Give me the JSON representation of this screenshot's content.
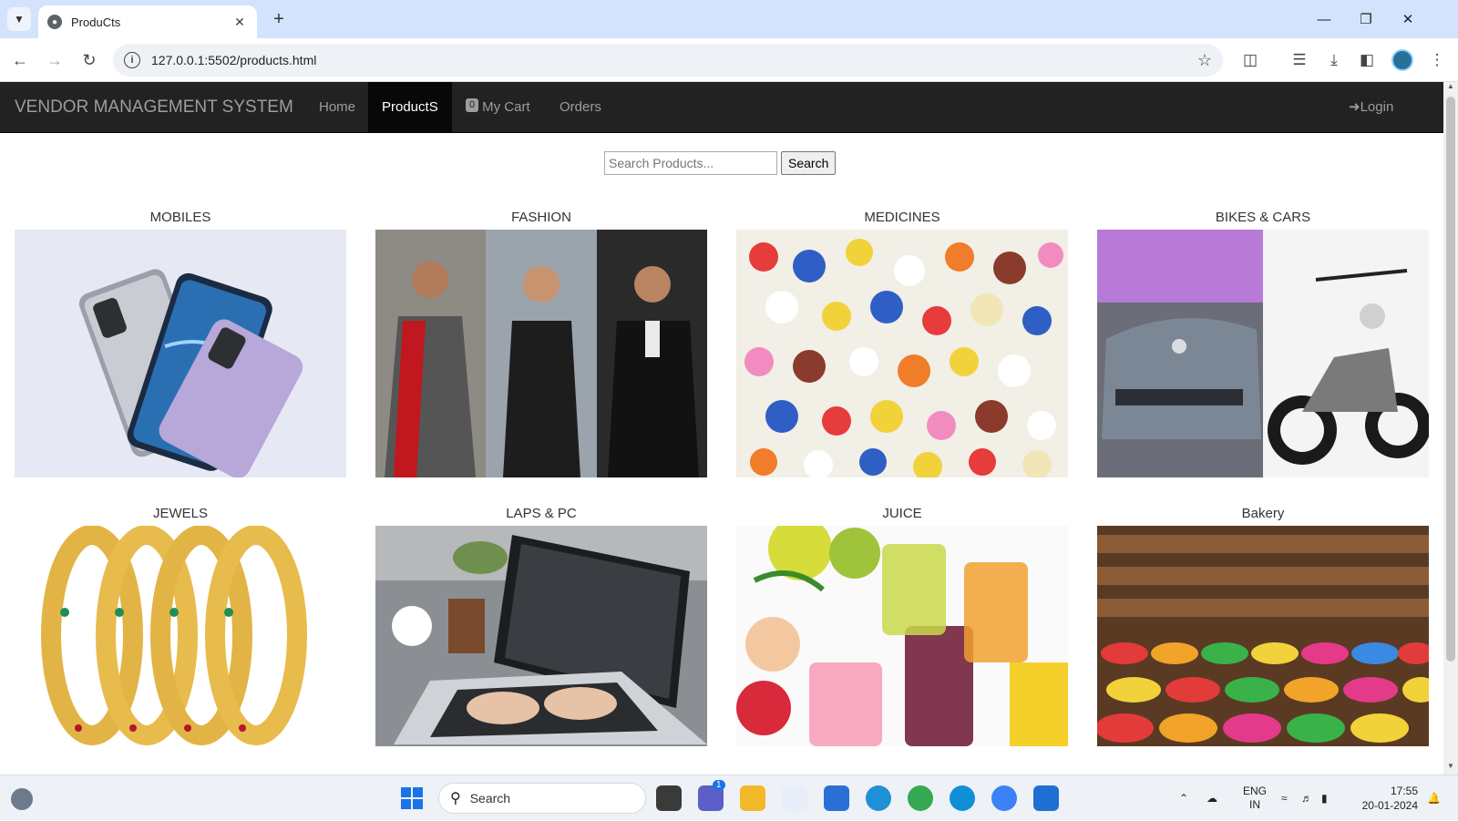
{
  "browser": {
    "tab_title": "ProduCts",
    "url": "127.0.0.1:5502/products.html"
  },
  "navbar": {
    "brand": "VENDOR MANAGEMENT SYSTEM",
    "links": [
      "Home",
      "ProductS",
      "My Cart",
      "Orders"
    ],
    "cart_count": "0",
    "login": "Login"
  },
  "search": {
    "placeholder": "Search Products...",
    "button": "Search"
  },
  "categories": [
    {
      "title": "MOBILES",
      "image": "phones"
    },
    {
      "title": "FASHION",
      "image": "fashion-models"
    },
    {
      "title": "MEDICINES",
      "image": "pills"
    },
    {
      "title": "BIKES & CARS",
      "image": "car-and-motorcycle"
    },
    {
      "title": "JEWELS",
      "image": "gold-bangles"
    },
    {
      "title": "LAPS & PC",
      "image": "laptop"
    },
    {
      "title": "JUICE",
      "image": "juices-and-fruits"
    },
    {
      "title": "Bakery",
      "image": "sweets-shop"
    }
  ],
  "taskbar": {
    "search_label": "Search",
    "notification_count": "1",
    "language": "ENG",
    "region": "IN",
    "time": "17:55",
    "date": "20-01-2024"
  },
  "colors": {
    "navbar_bg": "#222222",
    "nav_active_bg": "#080808",
    "nav_text": "#9d9d9d",
    "tabstrip": "#d3e3fd"
  }
}
